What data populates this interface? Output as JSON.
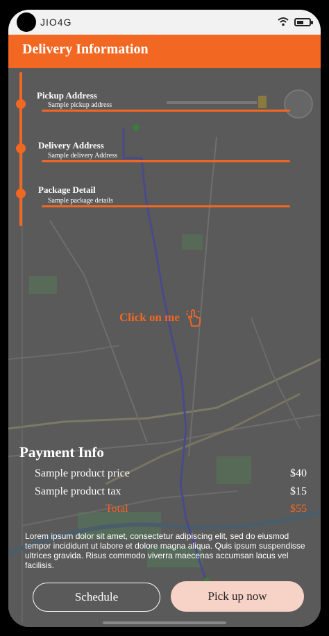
{
  "status": {
    "carrier": "JIO4G"
  },
  "header": {
    "title": "Delivery Information"
  },
  "steps": [
    {
      "title": "Pickup Address",
      "value": "Sample pickup address"
    },
    {
      "title": "Delivery Address",
      "value": "Sample delivery Address"
    },
    {
      "title": "Package Detail",
      "value": "Sample package details"
    }
  ],
  "map": {
    "cta": "Click on me",
    "icon": "pointer-hand-icon"
  },
  "payment": {
    "title": "Payment Info",
    "rows": [
      {
        "label": "Sample product price",
        "amount": "$40"
      },
      {
        "label": "Sample product tax",
        "amount": "$15"
      },
      {
        "label": "Total",
        "amount": "$55"
      }
    ],
    "description": "Lorem ipsum dolor sit amet, consectetur adipiscing elit, sed do eiusmod tempor incididunt ut labore et dolore magna aliqua. Quis ipsum suspendisse ultrices gravida. Risus commodo viverra maecenas accumsan lacus vel facilisis."
  },
  "actions": {
    "schedule": "Schedule",
    "pickup": "Pick up now"
  },
  "colors": {
    "accent": "#f26722",
    "pickup_button_bg": "#f6d2c7"
  }
}
